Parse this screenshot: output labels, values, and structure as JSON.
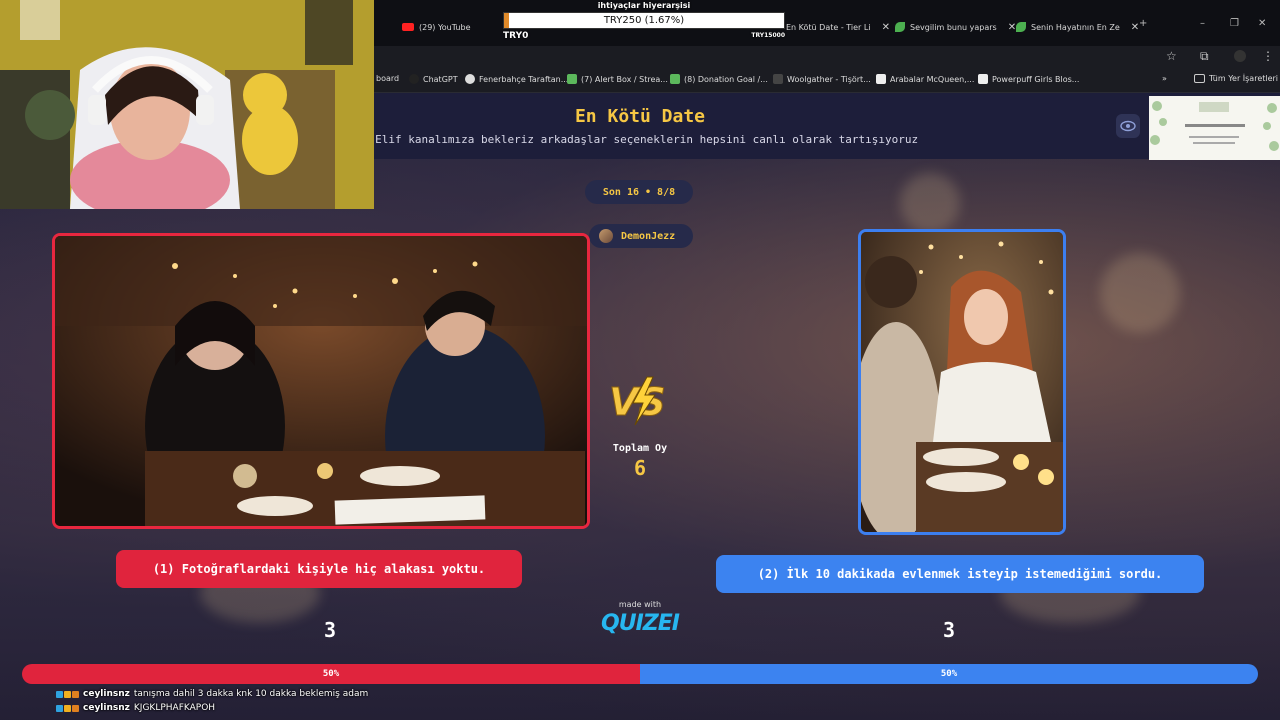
{
  "browser": {
    "tabs": [
      {
        "label": "(29) YouTube"
      },
      {
        "label": "En Kötü Date - Tier Li"
      },
      {
        "label": "Sevgilim bunu yapars"
      },
      {
        "label": "Senin Hayatının En Ze"
      }
    ],
    "bookmarks": [
      {
        "label": "board"
      },
      {
        "label": "ChatGPT"
      },
      {
        "label": "Fenerbahçe Taraftan..."
      },
      {
        "label": "(7) Alert Box / Strea..."
      },
      {
        "label": "(8) Donation Goal /..."
      },
      {
        "label": "Woolgather - Tişört..."
      },
      {
        "label": "Arabalar McQueen,..."
      },
      {
        "label": "Powerpuff Girls Blos..."
      }
    ],
    "bookmarks_more": "»",
    "all_bookmarks": "Tüm Yer İşaretleri"
  },
  "donation_goal": {
    "title": "ihtiyaçlar hiyerarşisi",
    "progress_text": "TRY250 (1.67%)",
    "progress_fraction": 0.0167,
    "min_label": "TRY0",
    "max_label": "TRY15000"
  },
  "quiz": {
    "title": "En Kötü Date",
    "subtitle": "k:Elif kanalımıza bekleriz arkadaşlar seçeneklerin hepsini canlı olarak tartışıyoruz",
    "round": "Son 16 • 8/8",
    "creator": "DemonJezz",
    "total_label": "Toplam Oy",
    "total_votes": "6",
    "option_left": {
      "label": "(1) Fotoğraflardaki kişiyle hiç alakası yoktu.",
      "votes": "3",
      "percent_label": "50%",
      "share": 0.5
    },
    "option_right": {
      "label": "(2) İlk 10 dakikada evlenmek isteyip istemediğimi sordu.",
      "votes": "3",
      "percent_label": "50%",
      "share": 0.5
    },
    "made_with": "made with",
    "brand": "QUIZEI",
    "colors": {
      "left": "#e0243d",
      "right": "#3c83f0",
      "accent": "#f6c744"
    }
  },
  "chat": [
    {
      "user": "ceylinsnz",
      "message": "tanışma dahil 3 dakka knk 10 dakka beklemiş adam"
    },
    {
      "user": "ceylinsnz",
      "message": "KJGKLPHAFKAPOH"
    }
  ]
}
